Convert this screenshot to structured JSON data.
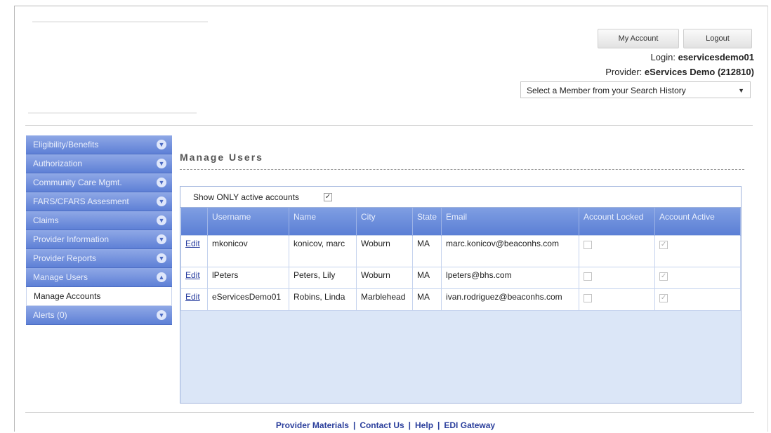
{
  "header": {
    "my_account_label": "My Account",
    "logout_label": "Logout",
    "login_prefix": "Login:",
    "login_value": "eservicesdemo01",
    "provider_prefix": "Provider:",
    "provider_value": "eServices Demo (212810)",
    "member_select_value": "Select a Member from your Search History"
  },
  "sidebar": {
    "items": [
      {
        "label": "Eligibility/Benefits"
      },
      {
        "label": "Authorization"
      },
      {
        "label": "Community Care Mgmt."
      },
      {
        "label": "FARS/CFARS Assesment"
      },
      {
        "label": "Claims"
      },
      {
        "label": "Provider Information"
      },
      {
        "label": "Provider Reports"
      },
      {
        "label": "Manage Users"
      },
      {
        "label": "Alerts (0)"
      }
    ],
    "submenu_manage_accounts": "Manage Accounts"
  },
  "main": {
    "title": "Manage Users",
    "filter_label": "Show ONLY active accounts",
    "filter_checked": true,
    "columns": [
      "",
      "Username",
      "Name",
      "City",
      "State",
      "Email",
      "Account Locked",
      "Account Active"
    ],
    "rows": [
      {
        "edit": "Edit",
        "username": "mkonicov",
        "name": "konicov, marc",
        "city": "Woburn",
        "state": "MA",
        "email": "marc.konicov@beaconhs.com",
        "locked": false,
        "active": true
      },
      {
        "edit": "Edit",
        "username": "lPeters",
        "name": "Peters, Lily",
        "city": "Woburn",
        "state": "MA",
        "email": "lpeters@bhs.com",
        "locked": false,
        "active": true
      },
      {
        "edit": "Edit",
        "username": "eServicesDemo01",
        "name": "Robins, Linda",
        "city": "Marblehead",
        "state": "MA",
        "email": "ivan.rodriguez@beaconhs.com",
        "locked": false,
        "active": true
      }
    ]
  },
  "footer": {
    "links": [
      "Provider Materials",
      "Contact Us",
      "Help",
      "EDI Gateway"
    ],
    "separator": "|"
  },
  "colors": {
    "sidebar_blue": "#5e80d6",
    "header_blue": "#5b7fd5",
    "panel_bg": "#dbe6f7",
    "link_blue": "#2b3f9c"
  }
}
